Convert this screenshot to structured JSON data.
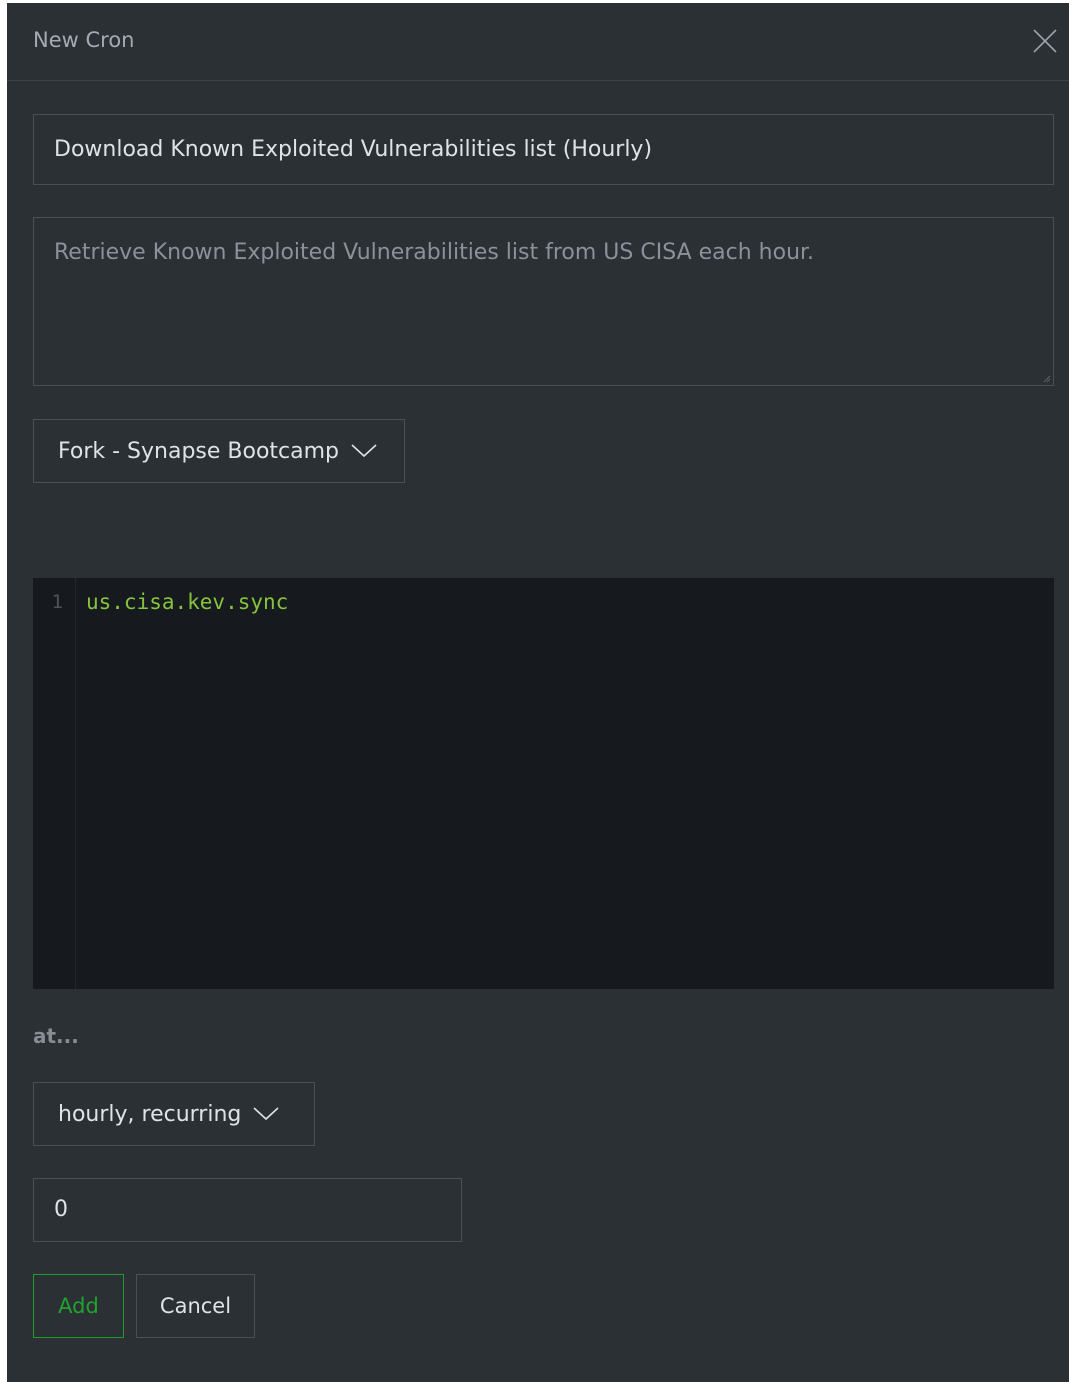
{
  "dialog": {
    "title": "New Cron",
    "close_icon": "close-icon"
  },
  "form": {
    "name_value": "Download Known Exploited Vulnerabilities list (Hourly)",
    "description_value": "Retrieve Known Exploited Vulnerabilities list from US CISA each hour.",
    "view_select_value": "Fork - Synapse Bootcamp",
    "editor": {
      "line_numbers": [
        "1"
      ],
      "code_lines": [
        "us.cisa.kev.sync"
      ]
    },
    "at_label": "at...",
    "schedule_select_value": "hourly, recurring",
    "minute_value": "0"
  },
  "actions": {
    "add_label": "Add",
    "cancel_label": "Cancel"
  },
  "colors": {
    "dialog_bg": "#2b3035",
    "editor_bg": "#161a1e",
    "code_text": "#86c43f",
    "add_accent": "#21a12f"
  }
}
